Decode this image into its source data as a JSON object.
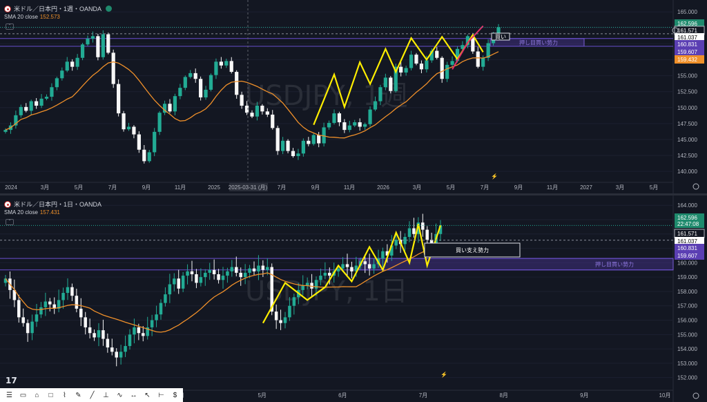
{
  "top": {
    "title": "米ドル／日本円・1週・OANDA",
    "sma_label": "SMA 20 close",
    "sma_value": "152.573",
    "watermark": "USDJPY, 1週",
    "y_ticks": [
      "165.000",
      "162.500",
      "160.000",
      "157.500",
      "155.000",
      "152.500",
      "150.000",
      "147.500",
      "145.000",
      "142.500",
      "140.000"
    ],
    "x_ticks": [
      "2024",
      "3月",
      "5月",
      "7月",
      "9月",
      "11月",
      "2025",
      "2025-03-31 (月)",
      "7月",
      "9月",
      "11月",
      "2026",
      "3月",
      "5月",
      "7月",
      "9月",
      "11月",
      "2027",
      "3月",
      "5月"
    ],
    "price_tags": [
      {
        "text": "162.596",
        "color": "#1f8a6d"
      },
      {
        "text": "161.571",
        "color": "#131722"
      },
      {
        "text": "161.037",
        "color": "#ffffff"
      },
      {
        "text": "160.831",
        "color": "#5b3fb3"
      },
      {
        "text": "159.607",
        "color": "#5b3fb3"
      },
      {
        "text": "159.432",
        "color": "#f0902a"
      }
    ],
    "zone_label": "押し目買い勢力",
    "box_label": "買い"
  },
  "bottom": {
    "title": "米ドル／日本円・1日・OANDA",
    "sma_label": "SMA 20 close",
    "sma_value": "157.431",
    "watermark": "USDJPY, 1日",
    "y_ticks": [
      "164.000",
      "163.000",
      "162.000",
      "161.000",
      "160.000",
      "159.000",
      "158.000",
      "157.000",
      "156.000",
      "155.000",
      "154.000",
      "153.000",
      "152.000"
    ],
    "x_ticks": [
      "月",
      "5月",
      "6月",
      "7月",
      "8月",
      "9月",
      "10月"
    ],
    "price_tags": [
      {
        "text": "162.596",
        "color": "#1f8a6d"
      },
      {
        "text": "22:47:08",
        "color": "#1f8a6d"
      },
      {
        "text": "161.571",
        "color": "#131722"
      },
      {
        "text": "161.037",
        "color": "#ffffff"
      },
      {
        "text": "160.831",
        "color": "#5b3fb3"
      },
      {
        "text": "159.607",
        "color": "#5b3fb3"
      }
    ],
    "support_label": "買い支え勢力",
    "zone_label": "押し目買い勢力"
  },
  "chart_data": [
    {
      "type": "candlestick",
      "title": "米ドル／日本円・1週・OANDA",
      "ylim": [
        138.5,
        166.0
      ],
      "close_series": [
        146.5,
        147.2,
        148.8,
        150.1,
        149.5,
        151.0,
        150.3,
        151.4,
        151.7,
        153.2,
        154.6,
        155.8,
        157.2,
        156.4,
        157.8,
        159.9,
        160.8,
        161.2,
        157.9,
        161.5,
        158.6,
        153.7,
        149.1,
        146.6,
        147.0,
        145.8,
        143.4,
        141.6,
        143.0,
        146.2,
        149.2,
        150.6,
        149.4,
        151.8,
        153.1,
        154.8,
        155.4,
        154.5,
        151.6,
        152.8,
        155.1,
        157.2,
        156.6,
        157.3,
        155.6,
        152.0,
        150.3,
        149.2,
        148.6,
        150.3,
        149.4,
        148.9,
        146.8,
        143.2,
        144.8,
        143.2,
        142.4,
        142.8,
        144.8,
        144.3,
        145.7,
        144.4,
        146.9,
        147.6,
        149.1,
        147.7,
        146.5,
        147.2,
        147.7,
        147.0,
        147.4,
        149.7,
        151.0,
        153.2,
        154.7,
        152.6,
        156.4,
        155.5,
        156.2,
        158.3,
        156.9,
        156.0,
        157.4,
        158.9,
        157.8,
        154.5,
        156.7,
        157.3,
        159.2,
        159.8,
        161.2,
        158.8,
        156.4,
        157.8,
        160.1,
        161.6,
        162.6
      ],
      "sma": 152.573,
      "series": [
        {
          "name": "SMA 20 close"
        }
      ]
    },
    {
      "type": "candlestick",
      "title": "米ドル／日本円・1日・OANDA",
      "ylim": [
        151.6,
        164.3
      ],
      "close_series": [
        158.9,
        158.1,
        157.4,
        156.2,
        155.8,
        155.1,
        155.9,
        156.4,
        156.9,
        157.3,
        157.1,
        156.8,
        157.4,
        157.9,
        158.3,
        157.7,
        156.8,
        156.2,
        155.5,
        155.1,
        154.8,
        155.3,
        154.7,
        154.1,
        153.8,
        153.4,
        153.8,
        154.2,
        155.0,
        155.5,
        155.1,
        154.9,
        155.5,
        156.0,
        156.4,
        157.2,
        157.8,
        158.5,
        158.9,
        158.2,
        159.1,
        159.4,
        159.2,
        158.6,
        159.0,
        159.3,
        159.5,
        159.2,
        158.8,
        159.1,
        159.4,
        159.7,
        159.3,
        159.0,
        159.3,
        159.6,
        159.4,
        159.8,
        159.5,
        159.7,
        156.6,
        156.0,
        155.8,
        156.2,
        157.0,
        157.6,
        158.1,
        158.4,
        158.6,
        158.2,
        158.8,
        159.1,
        159.3,
        159.1,
        159.4,
        159.6,
        159.9,
        159.7,
        159.4,
        159.8,
        160.1,
        159.9,
        159.6,
        159.9,
        160.3,
        160.8,
        160.5,
        161.2,
        161.6,
        161.3,
        161.8,
        162.4,
        162.0,
        162.8,
        162.3,
        161.6,
        161.3,
        162.0,
        162.6
      ],
      "sma": 157.431,
      "series": [
        {
          "name": "SMA 20 close"
        }
      ]
    }
  ]
}
